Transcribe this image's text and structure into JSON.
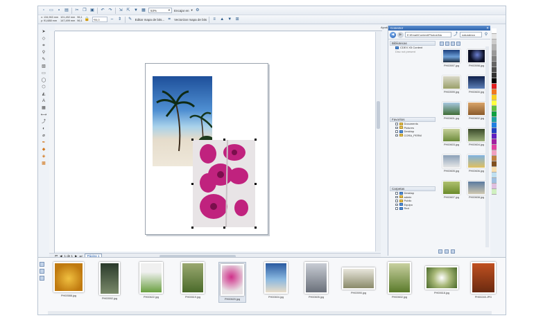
{
  "toolbar1": {
    "zoom_value": "53%",
    "snap_label": "Encajar en",
    "snap_arrow": "▾"
  },
  "toolbar2": {
    "x_coord": "x: 134,963 mm",
    "y_coord": "y: 91,688 mm",
    "w_coord": "101,452 mm",
    "h_coord": "147,499 mm",
    "scale_x": "96,1",
    "scale_y": "96,1",
    "angle": "0,0",
    "edit_bitmap_label": "Editar mapa de bits...",
    "trace_bitmap_label": "Vectorizar mapa de bits"
  },
  "docker": {
    "tab_label": "Ayudas",
    "title": "Conector",
    "address": "E:\\Email\\Content\\Photos\\Na",
    "search_value": "naturaleza",
    "libraries_label": "Bibliotecas",
    "libraries_item": "CDEX X5 Content",
    "libraries_subitem": "Disc not present",
    "favorites_label": "Favoritos",
    "favorites": [
      "Documents",
      "Pictures",
      "Desktop",
      "CORA_PERM"
    ],
    "folders_label": "Carpetas",
    "folders": [
      "Desktop",
      "admin",
      "Public",
      "Equipo",
      "Red"
    ],
    "grid_captions": [
      "PH00597.jpg",
      "PH00598.jpg",
      "PH00599.jpg",
      "PH00600.jpg",
      "PH00601.jpg",
      "PH00602.jpg",
      "PH00603.jpg",
      "PH00604.jpg",
      "PH00605.jpg",
      "PH00606.jpg",
      "PH00607.jpg",
      "PH00608.jpg"
    ]
  },
  "pagenav": {
    "position": "1 de 1",
    "page_tab": "Página 1"
  },
  "strip_captions": [
    "PH00588.jpg",
    "PH00592.jpg",
    "PH00622.jpg",
    "PH00619.jpg",
    "PH00620.jpg",
    "PH00604.jpg",
    "PH00605.jpg",
    "PH00590.jpg",
    "PH00602.jpg",
    "PH00618.jpg",
    "PH00245.JPG"
  ],
  "colors": {
    "accent": "#2f64ad",
    "palette": [
      "#ffffff",
      "#e6e6e6",
      "#cccccc",
      "#b3b3b3",
      "#999999",
      "#808080",
      "#666666",
      "#4d4d4d",
      "#333333",
      "#000000",
      "#e02020",
      "#f07820",
      "#f8d020",
      "#ffff40",
      "#60c040",
      "#10a040",
      "#20a0a0",
      "#2080e0",
      "#2040c0",
      "#6020c0",
      "#a020a0",
      "#e040a0",
      "#f0a0c0",
      "#c08040",
      "#805020",
      "#f8e0b0",
      "#c0e0f0",
      "#a0c0e0",
      "#e0c0e0",
      "#d0f0c0"
    ]
  }
}
